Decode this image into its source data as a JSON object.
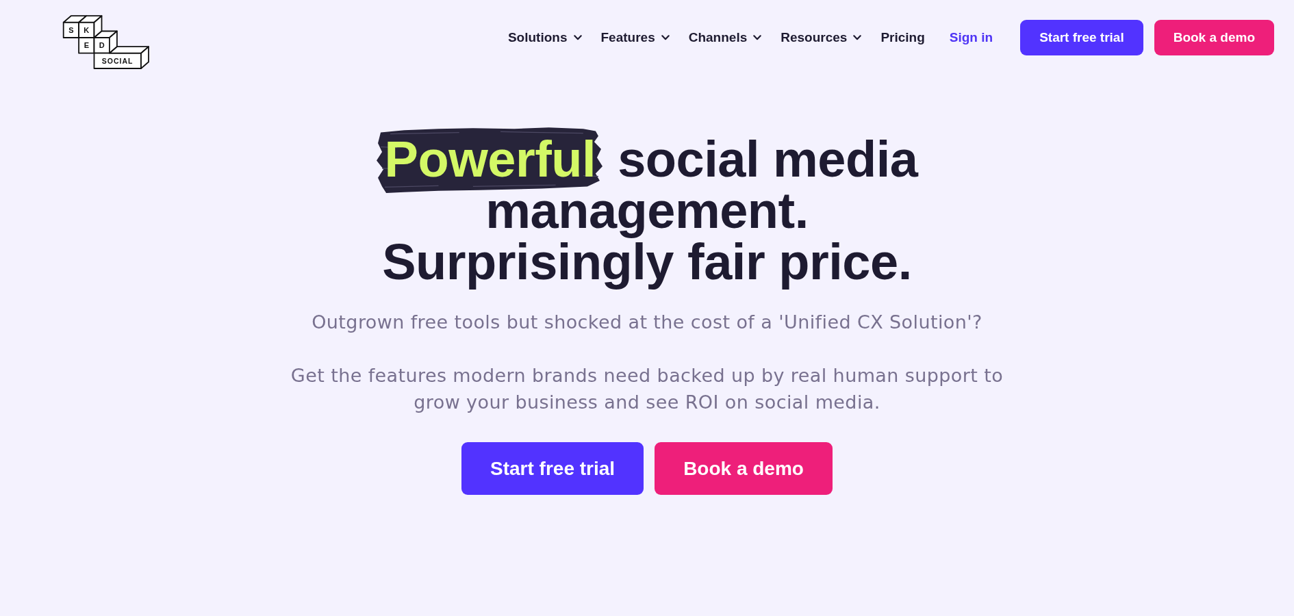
{
  "logo": {
    "blocks": [
      "S",
      "K",
      "E",
      "D",
      "SOCIAL"
    ]
  },
  "nav": {
    "items": [
      {
        "label": "Solutions",
        "kind": "menu"
      },
      {
        "label": "Features",
        "kind": "menu"
      },
      {
        "label": "Channels",
        "kind": "menu"
      },
      {
        "label": "Resources",
        "kind": "menu"
      },
      {
        "label": "Pricing",
        "kind": "link"
      },
      {
        "label": "Sign in",
        "kind": "signin"
      }
    ],
    "buttons": [
      {
        "label": "Start free trial",
        "kind": "primary"
      },
      {
        "label": "Book a demo",
        "kind": "secondary"
      }
    ]
  },
  "hero": {
    "headline": {
      "highlight": "Powerful",
      "text": "social media management. Surprisingly fair price."
    },
    "paragraphs": [
      "Outgrown free tools but shocked at the cost of a 'Unified CX Solution'?",
      "Get the features modern brands need backed up by real human support to grow your business and see ROI on social media."
    ],
    "buttons": [
      {
        "label": "Start free trial",
        "kind": "primary"
      },
      {
        "label": "Book a demo",
        "kind": "secondary"
      }
    ]
  }
}
